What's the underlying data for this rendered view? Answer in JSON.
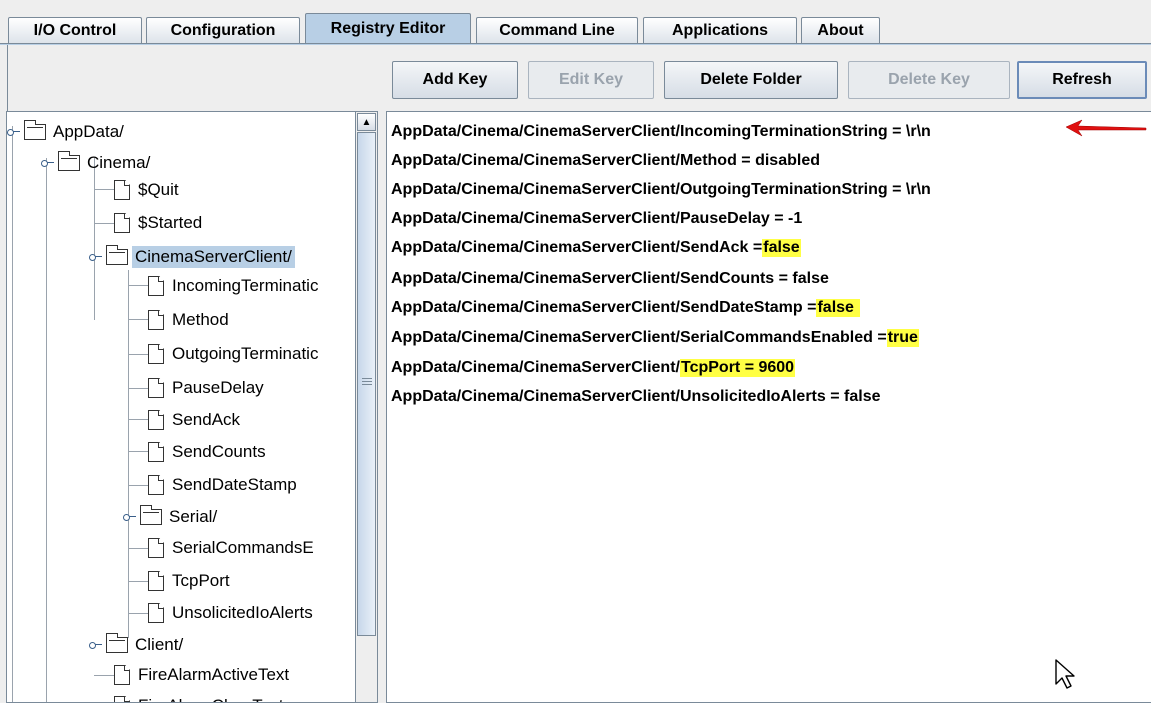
{
  "tabs": [
    {
      "label": "I/O Control"
    },
    {
      "label": "Configuration"
    },
    {
      "label": "Registry Editor"
    },
    {
      "label": "Command Line"
    },
    {
      "label": "Applications"
    },
    {
      "label": "About"
    }
  ],
  "active_tab": "Registry Editor",
  "toolbar": {
    "add_key": "Add Key",
    "edit_key": "Edit Key",
    "delete_folder": "Delete Folder",
    "delete_key": "Delete Key",
    "refresh": "Refresh"
  },
  "tree": {
    "appdata": "AppData/",
    "cinema": "Cinema/",
    "quit": "$Quit",
    "started": "$Started",
    "cinema_server_client": "CinemaServerClient/",
    "incoming": "IncomingTerminatic",
    "method": "Method",
    "outgoing": "OutgoingTerminatic",
    "pause_delay": "PauseDelay",
    "send_ack": "SendAck",
    "send_counts": "SendCounts",
    "send_date_stamp": "SendDateStamp",
    "serial": "Serial/",
    "serial_commands": "SerialCommandsE",
    "tcp_port": "TcpPort",
    "unsolicited": "UnsolicitedIoAlerts",
    "client": "Client/",
    "fire_alarm_active": "FireAlarmActiveText",
    "fire_alarm_clear": "FireAlarmClearText"
  },
  "entries": {
    "l1": {
      "text": "AppData/Cinema/CinemaServerClient/IncomingTerminationString = \\r\\n"
    },
    "l2": {
      "text": "AppData/Cinema/CinemaServerClient/Method = disabled"
    },
    "l3": {
      "text": "AppData/Cinema/CinemaServerClient/OutgoingTerminationString = \\r\\n"
    },
    "l4": {
      "text": "AppData/Cinema/CinemaServerClient/PauseDelay = -1"
    },
    "l5": {
      "pre": "AppData/Cinema/CinemaServerClient/SendAck = ",
      "hl": "false"
    },
    "l6": {
      "text": "AppData/Cinema/CinemaServerClient/SendCounts = false"
    },
    "l7": {
      "pre": "AppData/Cinema/CinemaServerClient/SendDateStamp = ",
      "hl": "false"
    },
    "l8": {
      "pre": "AppData/Cinema/CinemaServerClient/SerialCommandsEnabled = ",
      "hl": "true"
    },
    "l9": {
      "pre": "AppData/Cinema/CinemaServerClient/",
      "hl": "TcpPort = 9600"
    },
    "l10": {
      "text": "AppData/Cinema/CinemaServerClient/UnsolicitedIoAlerts = false"
    }
  },
  "colors": {
    "highlight": "#ffff44",
    "selection": "#b8cfe5",
    "annotation_arrow": "#e01010"
  }
}
